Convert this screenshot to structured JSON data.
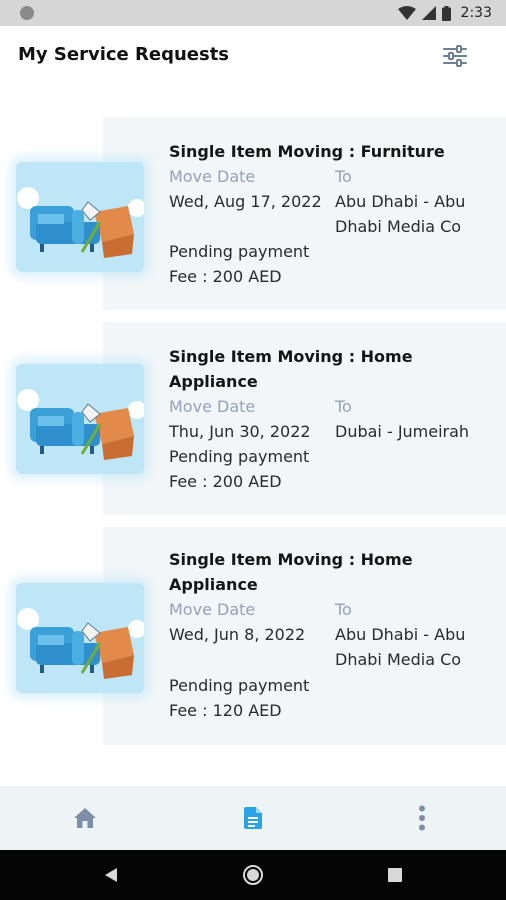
{
  "status_bar": {
    "time": "2:33",
    "icons": [
      "wifi-icon",
      "signal-icon",
      "battery-icon"
    ]
  },
  "header": {
    "title": "My Service Requests",
    "filter_icon": "filter-sliders-icon"
  },
  "requests": [
    {
      "title": "Single Item Moving : Furniture",
      "move_date_label": "Move Date",
      "move_date": "Wed, Aug 17, 2022",
      "to_label": "To",
      "to_line1": "Abu Dhabi - Abu",
      "to_line2": "Dhabi Media Co",
      "status": "Pending payment",
      "fee": "Fee : 200 AED"
    },
    {
      "title_line1": "Single Item Moving : Home",
      "title_line2": "Appliance",
      "move_date_label": "Move Date",
      "move_date": "Thu, Jun 30, 2022",
      "to_label": "To",
      "to_line1": "Dubai - Jumeirah",
      "status": "Pending payment",
      "fee": "Fee : 200 AED"
    },
    {
      "title_line1": "Single Item Moving : Home",
      "title_line2": "Appliance",
      "move_date_label": "Move Date",
      "move_date": "Wed, Jun 8, 2022",
      "to_label": "To",
      "to_line1": "Abu Dhabi - Abu",
      "to_line2": "Dhabi Media Co",
      "status": "Pending payment",
      "fee": "Fee : 120 AED"
    }
  ],
  "bottom_nav": {
    "items": [
      "home-icon",
      "document-icon",
      "more-vertical-icon"
    ],
    "active": "document-icon"
  },
  "colors": {
    "accent": "#2aa3e6",
    "card_bg": "#f2f6f8",
    "label": "#93a3ba",
    "nav_icon": "#7d8fa6"
  }
}
